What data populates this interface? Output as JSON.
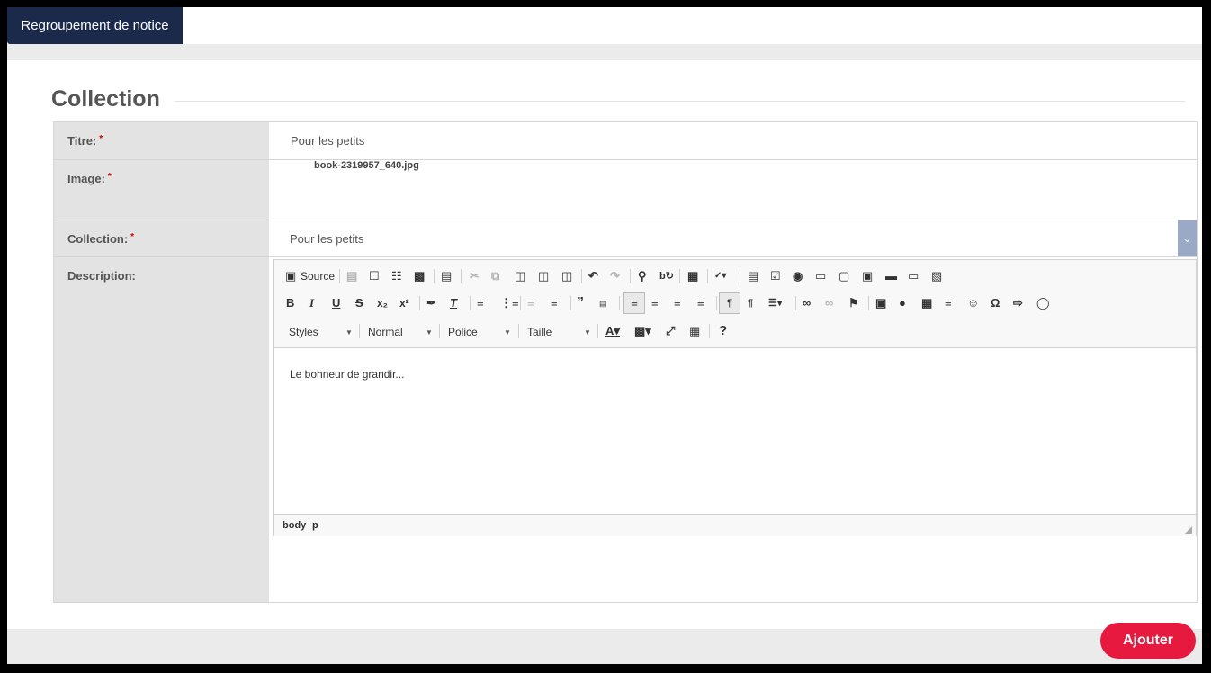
{
  "tab": {
    "label": "Regroupement de notice"
  },
  "section": {
    "title": "Collection"
  },
  "form": {
    "fields": [
      {
        "label": "Titre:",
        "required_mark": "*",
        "value": "Pour les petits"
      },
      {
        "label": "Image:",
        "required_mark": "*",
        "value": "book-2319957_640.jpg"
      },
      {
        "label": "Collection:",
        "required_mark": "*",
        "value": "Pour les petits"
      },
      {
        "label": "Description:"
      }
    ]
  },
  "editor": {
    "source_label": "Source",
    "combos": {
      "styles": "Styles",
      "format": "Normal",
      "font": "Police",
      "size": "Taille"
    },
    "content": "Le bohneur de grandir...",
    "status_path": [
      "body",
      "p"
    ],
    "icons": [
      "source-icon",
      "save-icon",
      "new-page-icon",
      "preview-icon",
      "print-icon",
      "templates-icon",
      "cut-icon",
      "copy-icon",
      "paste-icon",
      "paste-text-icon",
      "paste-word-icon",
      "undo-icon",
      "redo-icon",
      "find-icon",
      "replace-icon",
      "select-all-icon",
      "spellcheck-icon",
      "form-icon",
      "checkbox-icon",
      "radio-icon",
      "textfield-icon",
      "textarea-icon",
      "select-icon",
      "button-icon",
      "image-button-icon",
      "hidden-field-icon",
      "bold-icon",
      "italic-icon",
      "underline-icon",
      "strike-icon",
      "subscript-icon",
      "superscript-icon",
      "copy-format-icon",
      "remove-format-icon",
      "numbered-list-icon",
      "bulleted-list-icon",
      "outdent-icon",
      "indent-icon",
      "blockquote-icon",
      "div-icon",
      "align-left-icon",
      "align-center-icon",
      "align-right-icon",
      "justify-icon",
      "ltr-icon",
      "rtl-icon",
      "language-icon",
      "link-icon",
      "unlink-icon",
      "anchor-icon",
      "image-icon",
      "flash-icon",
      "table-icon",
      "hr-icon",
      "smiley-icon",
      "special-char-icon",
      "page-break-icon",
      "iframe-icon",
      "text-color-icon",
      "bg-color-icon",
      "maximize-icon",
      "show-blocks-icon",
      "help-icon"
    ]
  },
  "actions": {
    "add_label": "Ajouter"
  },
  "colors": {
    "tab_bg": "#1b2a4a",
    "add_button": "#e8193f",
    "select_arrow_bg": "#9aa9c6"
  }
}
